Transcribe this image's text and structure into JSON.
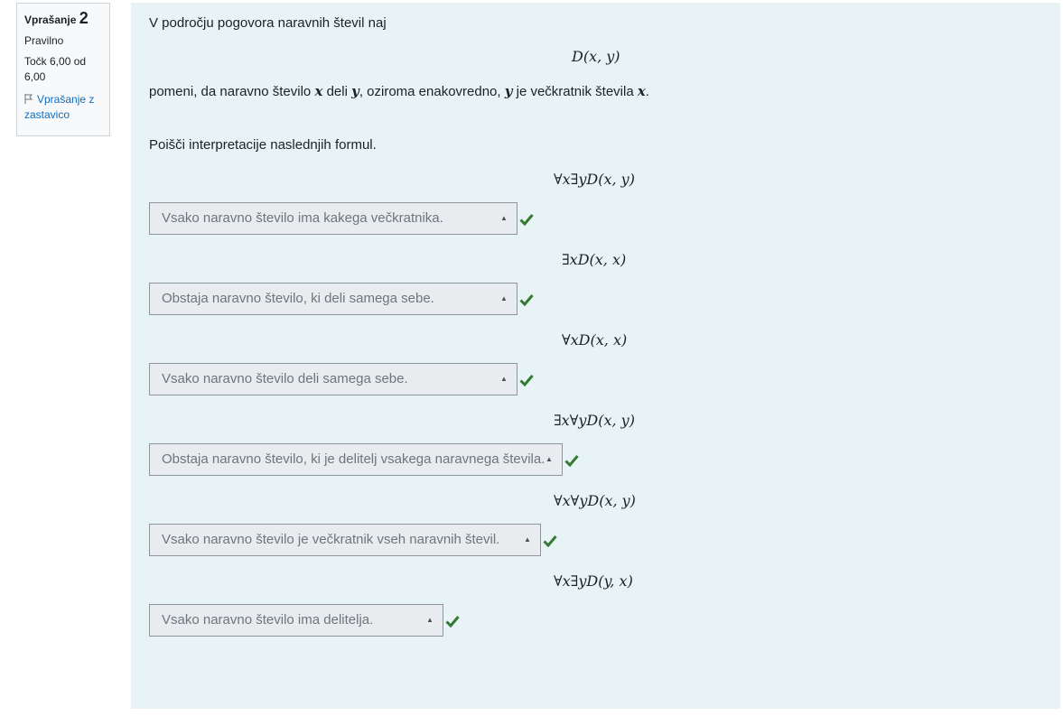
{
  "info": {
    "question_label": "Vprašanje",
    "question_number": "2",
    "status": "Pravilno",
    "points": "Točk 6,00 od 6,00",
    "flag_label": "Vprašanje z zastavico"
  },
  "question": {
    "intro": "V področju pogovora naravnih števil naj",
    "relation": "D(x, y)",
    "def_1": "pomeni, da naravno število ",
    "def_x": "x",
    "def_2": " deli ",
    "def_y": "y",
    "def_3": ", oziroma enakovredno, ",
    "def_y2": "y",
    "def_4": " je večkratnik števila ",
    "def_x2": "x",
    "def_5": ".",
    "task": "Poišči interpretacije naslednjih formul."
  },
  "items": [
    {
      "formula": "∀x∃yD(x, y)",
      "answer": "Vsako naravno število ima kakega večkratnika.",
      "correct": true
    },
    {
      "formula": "∃xD(x, x)",
      "answer": "Obstaja naravno število, ki deli samega sebe.",
      "correct": true
    },
    {
      "formula": "∀xD(x, x)",
      "answer": "Vsako naravno število deli samega sebe.",
      "correct": true
    },
    {
      "formula": "∃x∀yD(x, y)",
      "answer": "Obstaja naravno število, ki je delitelj vsakega naravnega števila.",
      "correct": true
    },
    {
      "formula": "∀x∀yD(x, y)",
      "answer": "Vsako naravno število je večkratnik vseh naravnih števil.",
      "correct": true
    },
    {
      "formula": "∀x∃yD(y, x)",
      "answer": "Vsako naravno število ima delitelja.",
      "correct": true
    }
  ],
  "colors": {
    "content_bg": "#e7f3f5",
    "check": "#357a32",
    "link": "#0f6cbf"
  }
}
